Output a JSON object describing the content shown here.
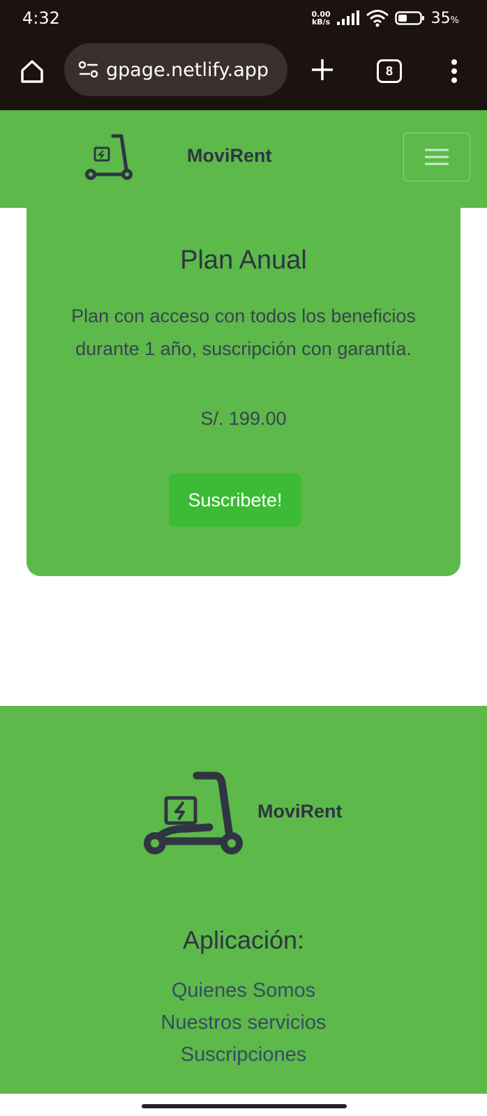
{
  "status_bar": {
    "time": "4:32",
    "net_speed_value": "0.00",
    "net_speed_unit": "kB/s",
    "battery_percent": "35",
    "battery_symbol": "%"
  },
  "browser": {
    "url": "gpage.netlify.app",
    "tab_count": "8"
  },
  "navbar": {
    "brand": "MoviRent"
  },
  "plan": {
    "title": "Plan Anual",
    "description": "Plan con acceso con todos los beneficios durante 1 año, suscripción con garantía.",
    "price": "S/. 199.00",
    "cta": "Suscribete!"
  },
  "footer": {
    "brand": "MoviRent",
    "heading": "Aplicación:",
    "links": [
      "Quienes Somos",
      "Nuestros servicios",
      "Suscripciones"
    ]
  },
  "colors": {
    "brand_green": "#5cb94a",
    "button_green": "#3bbb36",
    "dark_text": "#2f3541",
    "browser_chrome": "#1c1210"
  }
}
